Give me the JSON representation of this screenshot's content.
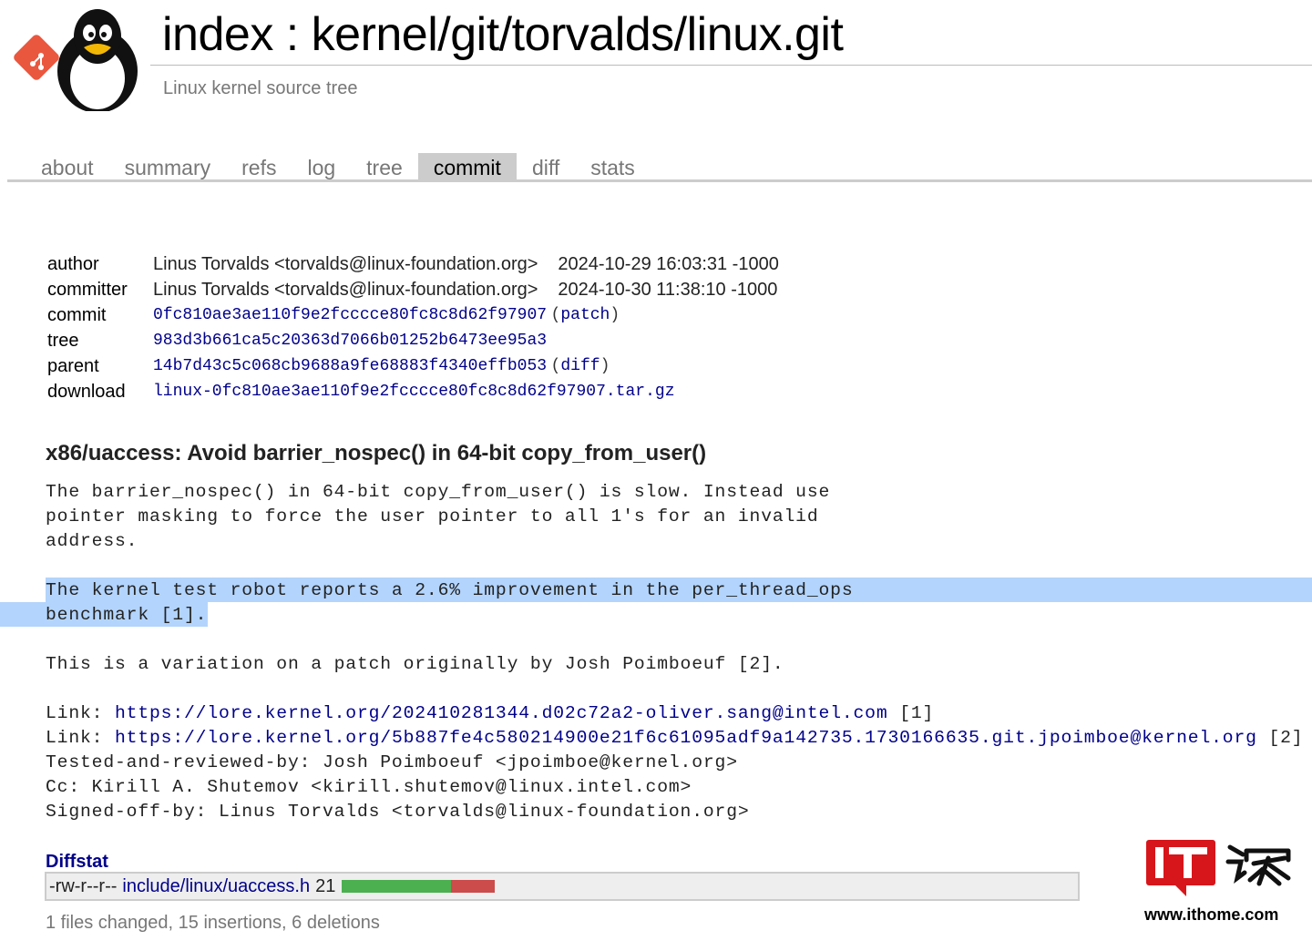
{
  "header": {
    "title": "index : kernel/git/torvalds/linux.git",
    "description": "Linux kernel source tree"
  },
  "tabs": [
    {
      "label": "about",
      "active": false
    },
    {
      "label": "summary",
      "active": false
    },
    {
      "label": "refs",
      "active": false
    },
    {
      "label": "log",
      "active": false
    },
    {
      "label": "tree",
      "active": false
    },
    {
      "label": "commit",
      "active": true
    },
    {
      "label": "diff",
      "active": false
    },
    {
      "label": "stats",
      "active": false
    }
  ],
  "commit_info": {
    "author_label": "author",
    "author": "Linus Torvalds <torvalds@linux-foundation.org>",
    "author_date": "2024-10-29 16:03:31 -1000",
    "committer_label": "committer",
    "committer": "Linus Torvalds <torvalds@linux-foundation.org>",
    "committer_date": "2024-10-30 11:38:10 -1000",
    "commit_label": "commit",
    "commit_sha": "0fc810ae3ae110f9e2fcccce80fc8c8d62f97907",
    "commit_extra_open": "(",
    "commit_extra": "patch",
    "commit_extra_close": ")",
    "tree_label": "tree",
    "tree_sha": "983d3b661ca5c20363d7066b01252b6473ee95a3",
    "parent_label": "parent",
    "parent_sha": "14b7d43c5c068cb9688a9fe68883f4340effb053",
    "parent_extra_open": "(",
    "parent_extra": "diff",
    "parent_extra_close": ")",
    "download_label": "download",
    "download_file": "linux-0fc810ae3ae110f9e2fcccce80fc8c8d62f97907.tar.gz"
  },
  "subject": "x86/uaccess: Avoid barrier_nospec() in 64-bit copy_from_user()",
  "message": {
    "line1": "The barrier_nospec() in 64-bit copy_from_user() is slow. Instead use",
    "line2": "pointer masking to force the user pointer to all 1's for an invalid",
    "line3": "address.",
    "line5": "The kernel test robot reports a 2.6% improvement in the per_thread_ops",
    "line6": "benchmark [1].",
    "line8": "This is a variation on a patch originally by Josh Poimboeuf [2].",
    "link_prefix": "Link: ",
    "link1_url": "https://lore.kernel.org/202410281344.d02c72a2-oliver.sang@intel.com",
    "link1_ref": " [1]",
    "link2_url": "https://lore.kernel.org/5b887fe4c580214900e21f6c61095adf9a142735.1730166635.git.jpoimboe@kernel.org",
    "link2_ref": " [2]",
    "tested": "Tested-and-reviewed-by: Josh Poimboeuf <jpoimboe@kernel.org>",
    "cc": "Cc: Kirill A. Shutemov <kirill.shutemov@linux.intel.com>",
    "signed": "Signed-off-by: Linus Torvalds <torvalds@linux-foundation.org>"
  },
  "diffstat": {
    "header": "Diffstat",
    "mode": "-rw-r--r--",
    "file": "include/linux/uaccess.h",
    "changes": "21",
    "insertions_count": 15,
    "deletions_count": 6,
    "summary": "1 files changed, 15 insertions, 6 deletions"
  },
  "watermark": {
    "logo_text": "IT之家",
    "site": "www.ithome.com"
  },
  "colors": {
    "link": "#00008b",
    "highlight": "#b3d4fc",
    "insertion": "#4caf50",
    "deletion": "#cc4b4b",
    "active_tab": "#cccccc",
    "watermark_red": "#d7161b"
  }
}
